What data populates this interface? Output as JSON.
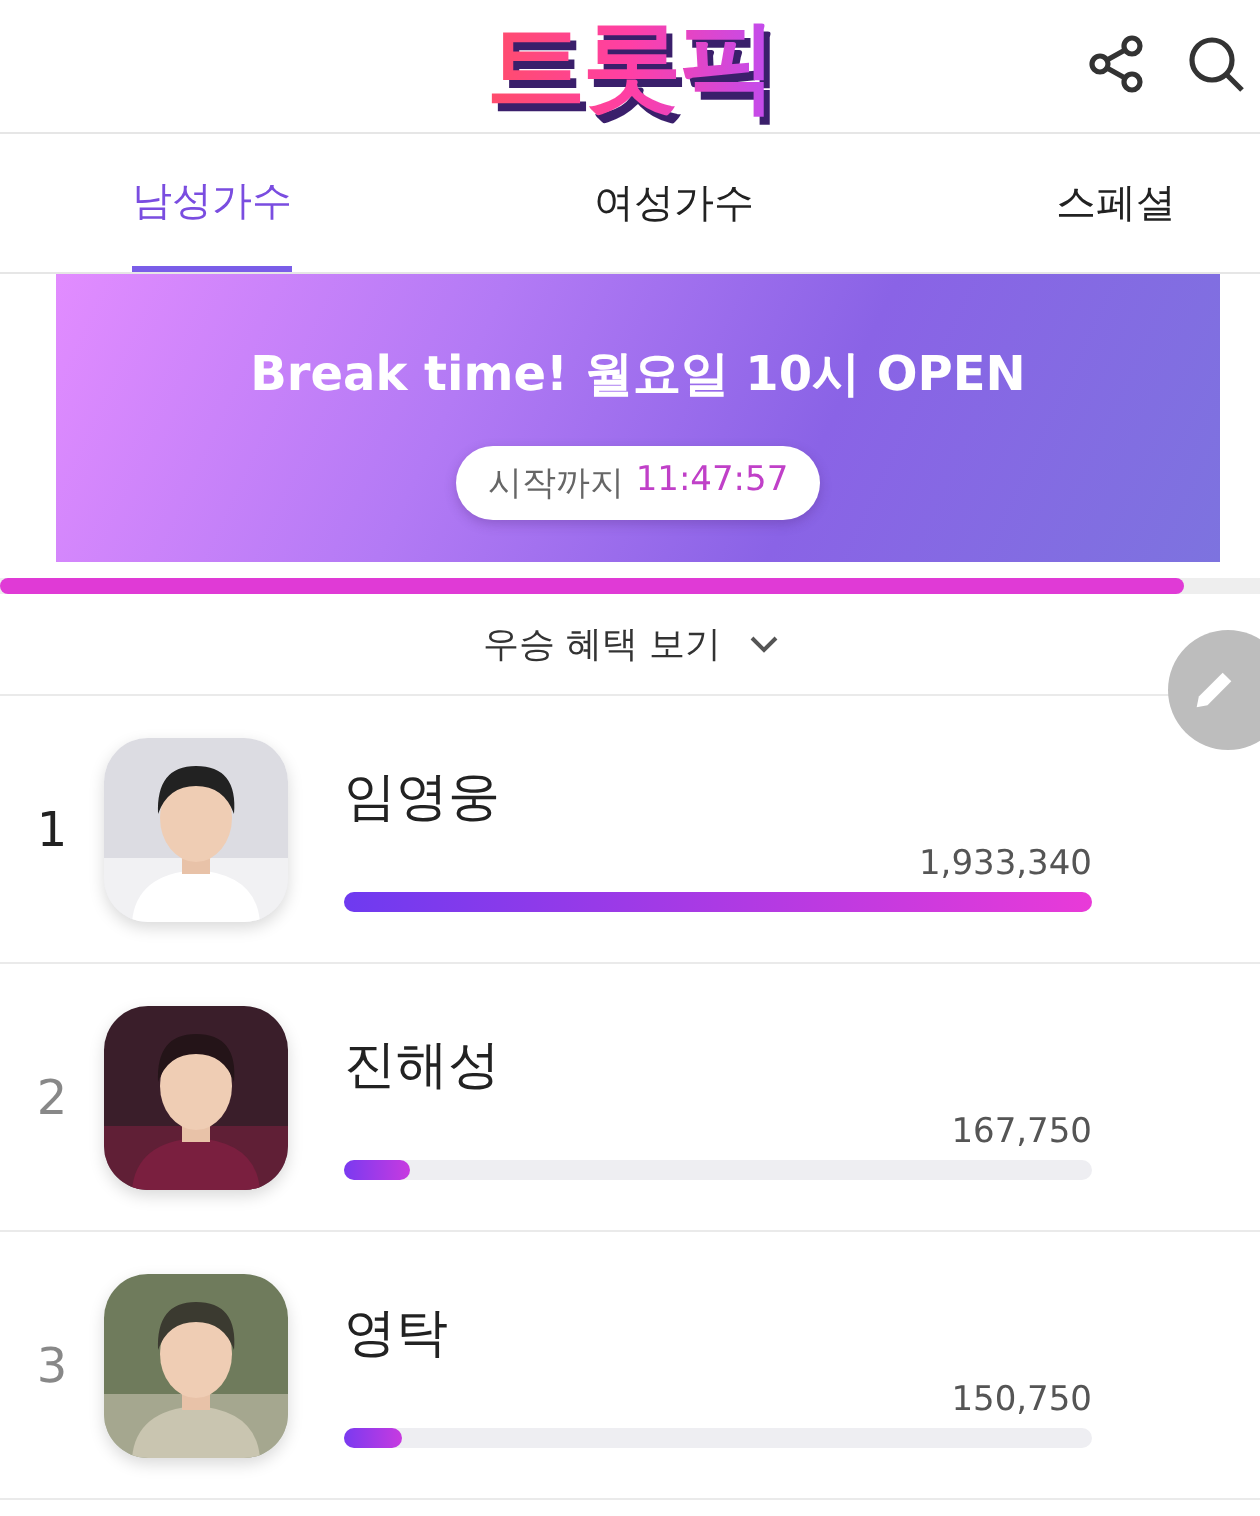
{
  "header": {
    "logo": "트롯픽"
  },
  "tabs": [
    {
      "label": "남성가수",
      "selected": true
    },
    {
      "label": "여성가수",
      "selected": false
    },
    {
      "label": "스페셜",
      "selected": false
    }
  ],
  "banner": {
    "title": "Break time! 월요일 10시 OPEN",
    "countdown_label": "시작까지",
    "countdown": "11:47:57"
  },
  "timer_progress": {
    "level": 0.94
  },
  "benefits_toggle": {
    "label": "우승 혜택 보기",
    "expanded": false
  },
  "ranking": [
    {
      "rank": "1",
      "name": "임영웅",
      "votes": "1,933,340",
      "level": 1.0,
      "top": true
    },
    {
      "rank": "2",
      "name": "진해성",
      "votes": "167,750",
      "level": 0.087,
      "top": false
    },
    {
      "rank": "3",
      "name": "영탁",
      "votes": "150,750",
      "level": 0.078,
      "top": false
    }
  ]
}
